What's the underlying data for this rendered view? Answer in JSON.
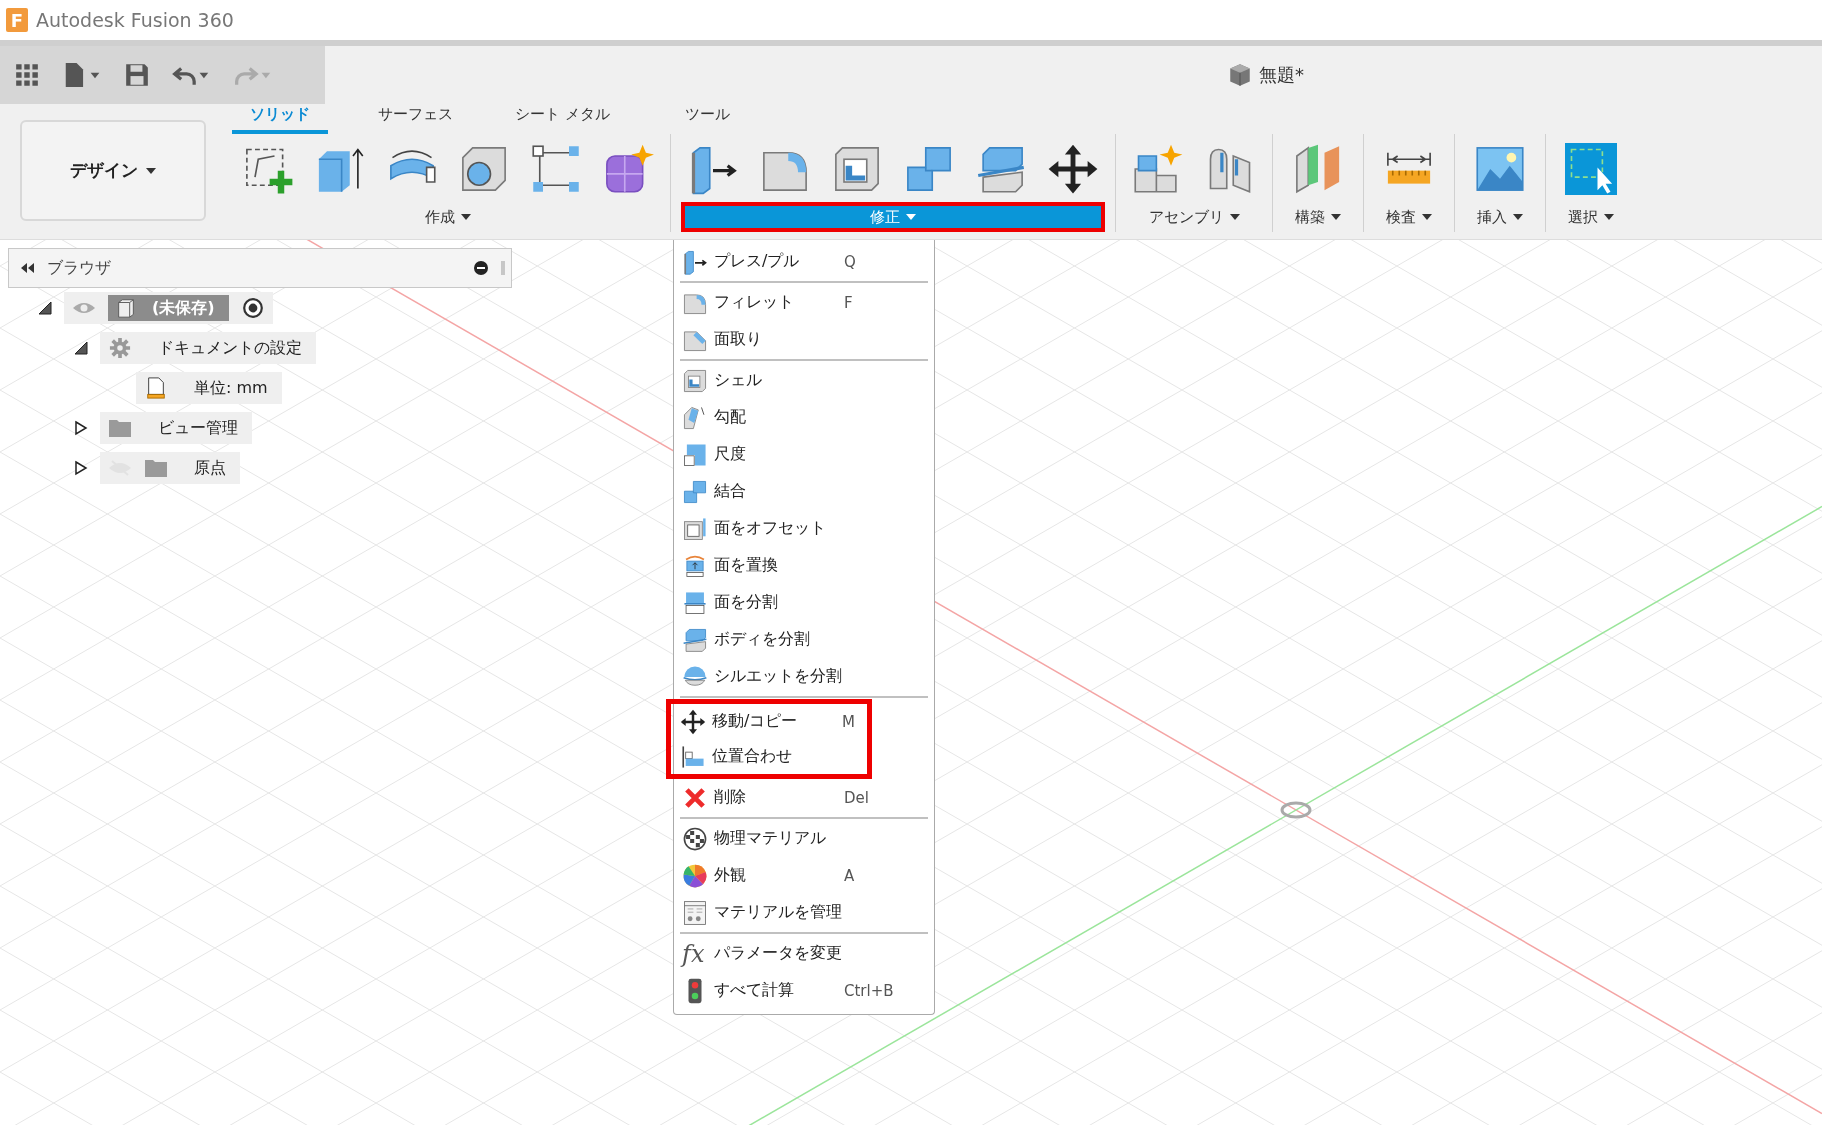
{
  "app": {
    "logo": "F",
    "title": "Autodesk Fusion 360"
  },
  "document": {
    "title": "無題*"
  },
  "workspace": {
    "label": "デザイン"
  },
  "tabs": [
    {
      "label": "ソリッド",
      "selected": true
    },
    {
      "label": "サーフェス",
      "selected": false
    },
    {
      "label": "シート メタル",
      "selected": false
    },
    {
      "label": "ツール",
      "selected": false
    }
  ],
  "groups": [
    {
      "label": "作成",
      "open": false,
      "marked": false,
      "tools": [
        {
          "kind": "sketch"
        },
        {
          "kind": "extrude"
        },
        {
          "kind": "revolve"
        },
        {
          "kind": "hole"
        },
        {
          "kind": "pattern"
        },
        {
          "kind": "form"
        }
      ]
    },
    {
      "label": "修正",
      "open": true,
      "marked": true,
      "tools": [
        {
          "kind": "presspull"
        },
        {
          "kind": "fillet"
        },
        {
          "kind": "shell"
        },
        {
          "kind": "combine"
        },
        {
          "kind": "split-body"
        },
        {
          "kind": "move"
        }
      ]
    },
    {
      "label": "アセンブリ",
      "open": false,
      "marked": false,
      "tools": [
        {
          "kind": "new-component"
        },
        {
          "kind": "joint"
        }
      ]
    },
    {
      "label": "構築",
      "open": false,
      "marked": false,
      "tools": [
        {
          "kind": "plane"
        }
      ]
    },
    {
      "label": "検査",
      "open": false,
      "marked": false,
      "tools": [
        {
          "kind": "measure"
        }
      ]
    },
    {
      "label": "挿入",
      "open": false,
      "marked": false,
      "tools": [
        {
          "kind": "image"
        }
      ]
    },
    {
      "label": "選択",
      "open": false,
      "marked": false,
      "tools": [
        {
          "kind": "select"
        }
      ]
    }
  ],
  "browser": {
    "title": "ブラウザ",
    "tree": [
      {
        "label": "(未保存)",
        "kind": "component",
        "expanded": true,
        "visible": true,
        "active": true,
        "children": [
          {
            "label": "ドキュメントの設定",
            "kind": "settings",
            "expanded": true,
            "children": [
              {
                "label": "単位: mm",
                "kind": "units"
              }
            ]
          },
          {
            "label": "ビュー管理",
            "kind": "folder",
            "expanded": false
          },
          {
            "label": "原点",
            "kind": "folder",
            "expanded": false,
            "visible": false
          }
        ]
      }
    ]
  },
  "menu": {
    "sections": [
      {
        "items": [
          {
            "label": "プレス/プル",
            "shortcut": "Q",
            "kind": "presspull",
            "marked": false
          }
        ]
      },
      {
        "items": [
          {
            "label": "フィレット",
            "shortcut": "F",
            "kind": "fillet",
            "marked": false
          },
          {
            "label": "面取り",
            "kind": "chamfer",
            "marked": false
          }
        ]
      },
      {
        "items": [
          {
            "label": "シェル",
            "kind": "shell",
            "marked": false
          },
          {
            "label": "勾配",
            "kind": "draft",
            "marked": false
          },
          {
            "label": "尺度",
            "kind": "scale",
            "marked": false
          },
          {
            "label": "結合",
            "kind": "combine",
            "marked": false
          },
          {
            "label": "面をオフセット",
            "kind": "offset-face",
            "marked": false
          },
          {
            "label": "面を置換",
            "kind": "replace-face",
            "marked": false
          },
          {
            "label": "面を分割",
            "kind": "split-face",
            "marked": false
          },
          {
            "label": "ボディを分割",
            "kind": "split-body",
            "marked": false
          },
          {
            "label": "シルエットを分割",
            "kind": "split-silhouette",
            "marked": false
          }
        ]
      },
      {
        "items": [
          {
            "label": "移動/コピー",
            "shortcut": "M",
            "kind": "move",
            "marked": true
          },
          {
            "label": "位置合わせ",
            "kind": "align",
            "marked": true
          },
          {
            "label": "削除",
            "shortcut": "Del",
            "kind": "delete",
            "marked": false
          }
        ]
      },
      {
        "items": [
          {
            "label": "物理マテリアル",
            "kind": "physical-material",
            "marked": false
          },
          {
            "label": "外観",
            "shortcut": "A",
            "kind": "appearance",
            "marked": false
          },
          {
            "label": "マテリアルを管理",
            "kind": "manage-materials",
            "marked": false
          }
        ]
      },
      {
        "items": [
          {
            "label": "パラメータを変更",
            "kind": "parameters",
            "glyph": "fx",
            "marked": false
          },
          {
            "label": "すべて計算",
            "shortcut": "Ctrl+B",
            "kind": "compute",
            "marked": false
          }
        ]
      }
    ]
  }
}
